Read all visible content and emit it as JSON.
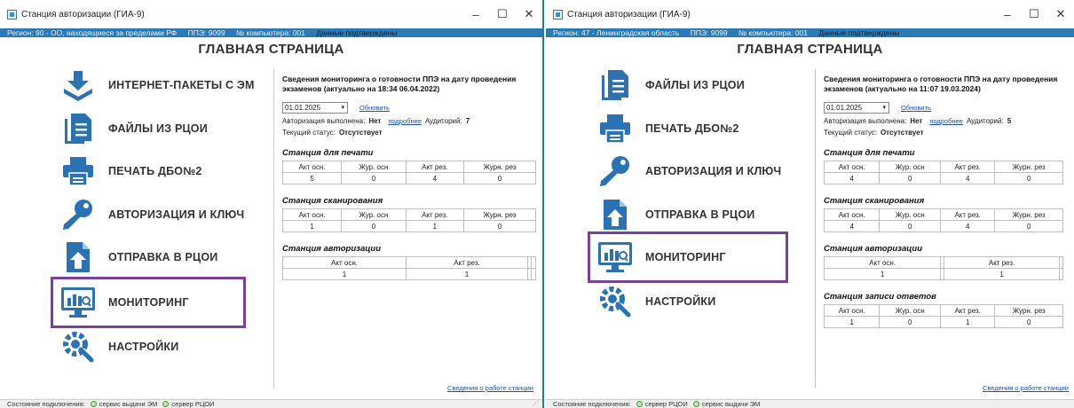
{
  "colors": {
    "accent": "#2a7ab8",
    "selection": "#7b3fa0",
    "link": "#1a4fc9",
    "icon": "#2a72b4"
  },
  "windows": [
    {
      "title": "Станция авторизации (ГИА-9)",
      "info": {
        "region": "Регион: 90 - ОО, находящиеся за пределами РФ",
        "ppe": "ППЭ: 9099",
        "computer": "№ компьютера: 001",
        "confirm": "Данные подтверждены"
      },
      "page_title": "ГЛАВНАЯ СТРАНИЦА",
      "menu": [
        {
          "icon": "download-icon",
          "label": "ИНТЕРНЕТ-ПАКЕТЫ С ЭМ"
        },
        {
          "icon": "documents-icon",
          "label": "ФАЙЛЫ ИЗ РЦОИ"
        },
        {
          "icon": "printer-icon",
          "label": "ПЕЧАТЬ ДБО№2"
        },
        {
          "icon": "key-icon",
          "label": "АВТОРИЗАЦИЯ И КЛЮЧ"
        },
        {
          "icon": "upload-document-icon",
          "label": "ОТПРАВКА В РЦОИ"
        },
        {
          "icon": "monitoring-icon",
          "label": "МОНИТОРИНГ"
        },
        {
          "icon": "settings-icon",
          "label": "НАСТРОЙКИ"
        }
      ],
      "panel": {
        "heading": "Сведения мониторинга о готовности ППЭ на дату проведения экзаменов (актуально на 18:34 06.04.2022)",
        "date": "01.01.2025",
        "refresh": "Обновить",
        "auth_label": "Авторизация выполнена:",
        "auth_value": "Нет",
        "details": "подробнее",
        "rooms_label": "Аудиторий:",
        "rooms_value": "7",
        "status_label": "Текущий статус:",
        "status_value": "Отсутствует",
        "sections": [
          {
            "title": "Станция для печати",
            "headers": [
              "Акт осн.",
              "Жур. осн",
              "Акт рез.",
              "Журн. рез"
            ],
            "values": [
              "5",
              "0",
              "4",
              "0"
            ]
          },
          {
            "title": "Станция сканирования",
            "headers": [
              "Акт осн.",
              "Жур. осн",
              "Акт рез.",
              "Журн. рез"
            ],
            "values": [
              "1",
              "0",
              "1",
              "0"
            ]
          },
          {
            "title": "Станция авторизации",
            "headers": [
              "Акт осн.",
              "Акт рез.",
              "",
              ""
            ],
            "values": [
              "1",
              "1",
              "",
              ""
            ]
          }
        ]
      },
      "footer_link": "Сведения о работе станции",
      "status": {
        "label": "Состояние подключения:",
        "s1": "сервис выдачи ЭМ",
        "s2": "сервер РЦОИ"
      }
    },
    {
      "title": "Станция авторизации (ГИА-9)",
      "info": {
        "region": "Регион: 47 - Ленинградская область",
        "ppe": "ППЭ: 9099",
        "computer": "№ компьютера: 001",
        "confirm": "Данные подтверждены"
      },
      "page_title": "ГЛАВНАЯ СТРАНИЦА",
      "menu": [
        {
          "icon": "documents-icon",
          "label": "ФАЙЛЫ ИЗ РЦОИ"
        },
        {
          "icon": "printer-icon",
          "label": "ПЕЧАТЬ ДБО№2"
        },
        {
          "icon": "key-icon",
          "label": "АВТОРИЗАЦИЯ И КЛЮЧ"
        },
        {
          "icon": "upload-document-icon",
          "label": "ОТПРАВКА В РЦОИ"
        },
        {
          "icon": "monitoring-icon",
          "label": "МОНИТОРИНГ"
        },
        {
          "icon": "settings-icon",
          "label": "НАСТРОЙКИ"
        }
      ],
      "panel": {
        "heading": "Сведения мониторинга о готовности ППЭ на дату проведения экзаменов (актуально на 11:07 19.03.2024)",
        "date": "01.01.2025",
        "refresh": "Обновить",
        "auth_label": "Авторизация выполнена:",
        "auth_value": "Нет",
        "details": "подробнее",
        "rooms_label": "Аудиторий:",
        "rooms_value": "5",
        "status_label": "Текущий статус:",
        "status_value": "Отсутствует",
        "sections": [
          {
            "title": "Станция для печати",
            "headers": [
              "Акт осн.",
              "Жур. осн",
              "Акт рез.",
              "Журн. рез"
            ],
            "values": [
              "4",
              "0",
              "4",
              "0"
            ]
          },
          {
            "title": "Станция сканирования",
            "headers": [
              "Акт осн.",
              "Жур. осн",
              "Акт рез.",
              "Журн. рез"
            ],
            "values": [
              "4",
              "0",
              "4",
              "0"
            ]
          },
          {
            "title": "Станция авторизации",
            "headers": [
              "Акт осн.",
              "",
              "Акт рез.",
              ""
            ],
            "values": [
              "1",
              "",
              "1",
              ""
            ]
          },
          {
            "title": "Станция записи ответов",
            "headers": [
              "Акт осн.",
              "Жур. осн",
              "Акт рез.",
              "Журн. рез"
            ],
            "values": [
              "1",
              "0",
              "1",
              "0"
            ]
          }
        ]
      },
      "footer_link": "Сведения о работе станции",
      "status": {
        "label": "Состояние подключения:",
        "s1": "сервер РЦОИ",
        "s2": "сервис выдачи ЭМ"
      }
    }
  ]
}
